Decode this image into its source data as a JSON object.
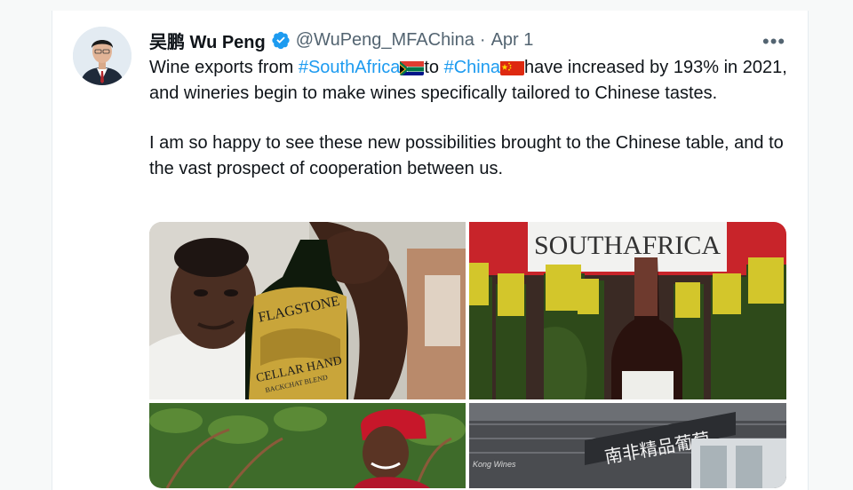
{
  "author": {
    "display_name": "吴鹏 Wu Peng",
    "handle": "@WuPeng_MFAChina",
    "separator": "·",
    "date": "Apr 1"
  },
  "more_label": "•••",
  "tweet": {
    "p1_a": "Wine exports from ",
    "tag1": "#SouthAfrica",
    "p1_b": "to ",
    "tag2": "#China",
    "p1_c": "have increased by 193% in 2021, and wineries begin to make wines specifically tailored to Chinese tastes.",
    "p2": "I am so happy to see these new possibilities brought to the Chinese table, and to the vast prospect of cooperation between us."
  },
  "media": {
    "photo1": {
      "bottle_label_top": "FLAGSTONE",
      "bottle_label_mid": "CELLAR HAND",
      "bottle_label_sub": "BACKCHAT BLEND"
    },
    "photo2": {
      "sign": "SOUTHAFRICA"
    },
    "photo4": {
      "sign": "南非精品葡萄",
      "watermark": "Kong Wines"
    }
  },
  "colors": {
    "link": "#1d9bf0",
    "verified": "#1d9bf0",
    "muted": "#536471"
  }
}
